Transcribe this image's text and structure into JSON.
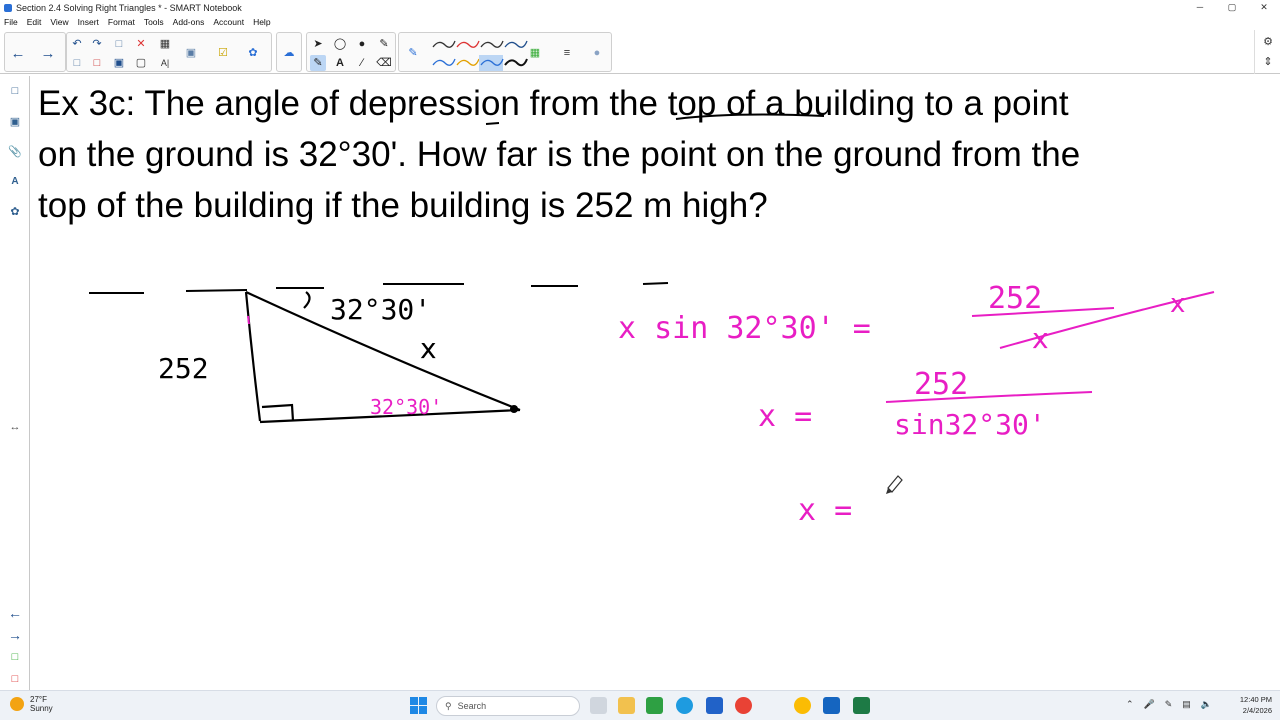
{
  "window": {
    "title": "Section 2.4 Solving Right Triangles * - SMART Notebook",
    "min_icon": "minimize-icon",
    "max_icon": "maximize-icon",
    "close_icon": "close-icon",
    "min_glyph": "─",
    "max_glyph": "▢",
    "close_glyph": "✕"
  },
  "menu": {
    "items": [
      "File",
      "Edit",
      "View",
      "Insert",
      "Format",
      "Tools",
      "Add-ons",
      "Account",
      "Help"
    ]
  },
  "problem": {
    "text": "Ex 3c: The angle of depression from the top of a building to a point\non the ground is 32°30'. How far is the point on the ground from the\ntop of the building if the building is 252 m high?"
  },
  "handwriting": {
    "angle_top": "32°30'",
    "hypotenuse": "x",
    "height": "252",
    "angle_bottom": "32°30'",
    "eq1_left": "x sin 32°30' =",
    "eq1_num": "252",
    "eq1_den": "x",
    "eq1_cancel": "x",
    "eq2_left": "x =",
    "eq2_num": "252",
    "eq2_den": "sin32°30'",
    "eq3_left": "x ="
  },
  "colors": {
    "ink_black": "#000000",
    "ink_magenta": "#e81ec4",
    "toolbar_selected": "#bcd6f4",
    "taskbar": "#eef2f7"
  },
  "taskbar": {
    "weather_temp": "27°F",
    "weather_desc": "Sunny",
    "search_placeholder": "Search",
    "time": "12:40 PM",
    "date": "2/4/2026"
  }
}
